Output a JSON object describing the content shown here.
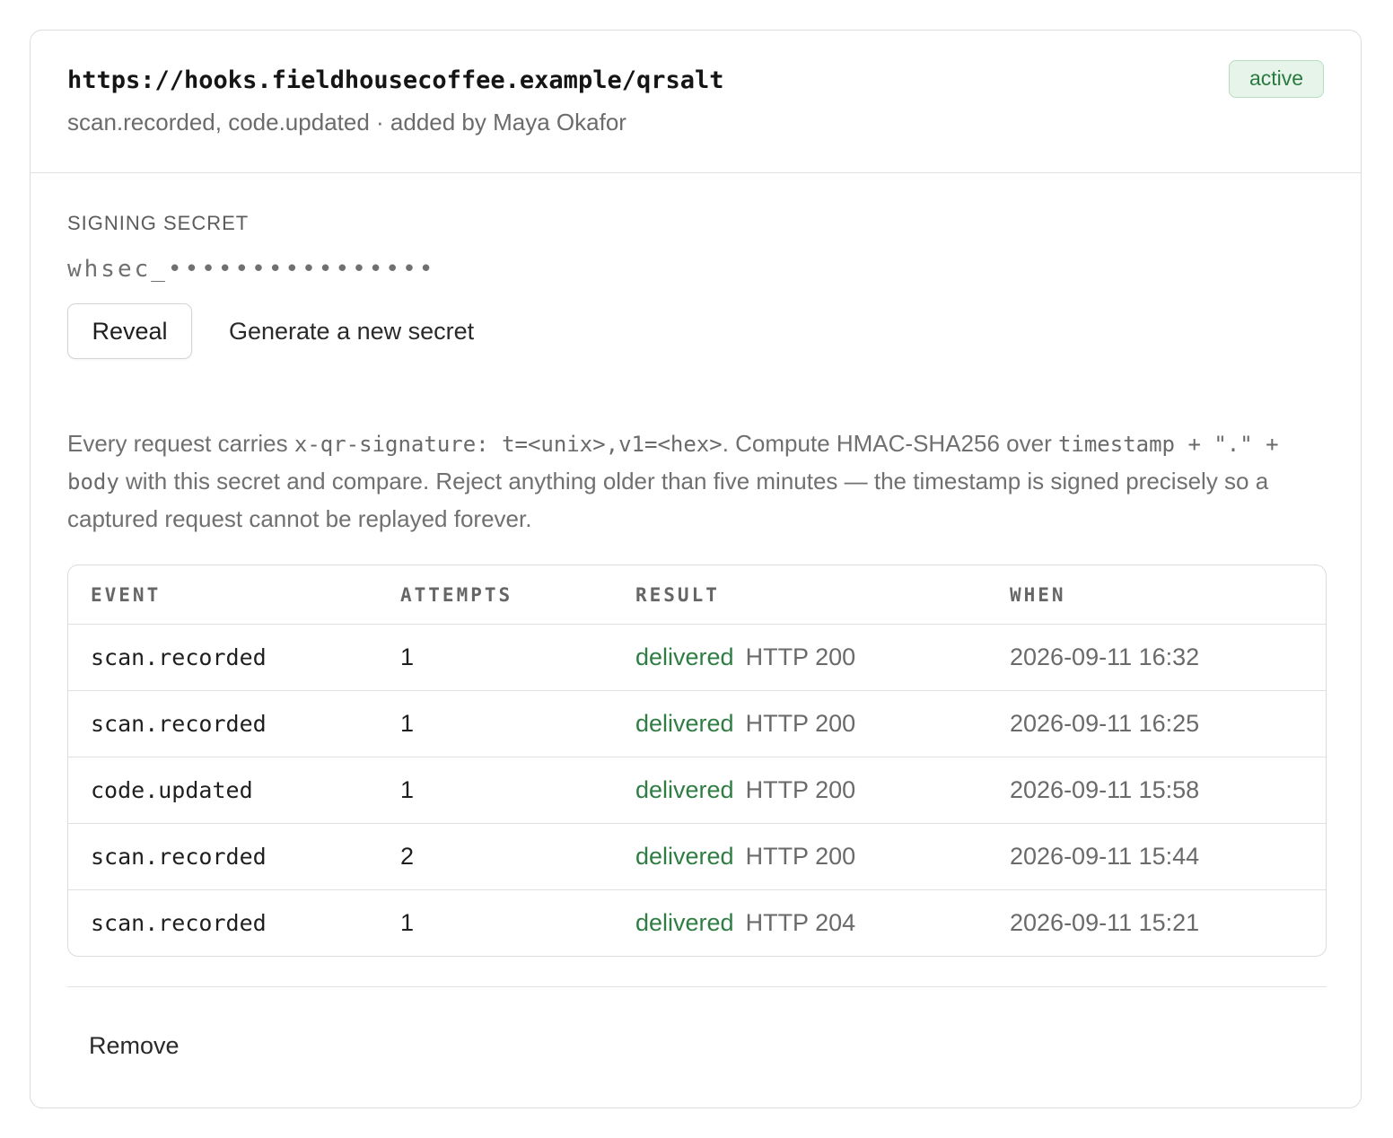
{
  "webhook": {
    "url": "https://hooks.fieldhousecoffee.example/qrsalt",
    "meta": "scan.recorded, code.updated · added by Maya Okafor",
    "status": "active"
  },
  "secret": {
    "label": "SIGNING SECRET",
    "masked_value": "whsec_••••••••••••••••",
    "reveal_label": "Reveal",
    "generate_label": "Generate a new secret"
  },
  "description": {
    "t1": "Every request carries ",
    "c1": "x-qr-signature: t=<unix>,v1=<hex>",
    "t2": ". Compute HMAC-SHA256 over ",
    "c2": "timestamp + \".\" + body",
    "t3": " with this secret and compare. Reject anything older than five minutes — the timestamp is signed precisely so a captured request cannot be replayed forever."
  },
  "deliveries": {
    "headers": [
      "EVENT",
      "ATTEMPTS",
      "RESULT",
      "WHEN"
    ],
    "rows": [
      {
        "event": "scan.recorded",
        "attempts": "1",
        "result": "delivered",
        "http": "HTTP 200",
        "when": "2026-09-11 16:32"
      },
      {
        "event": "scan.recorded",
        "attempts": "1",
        "result": "delivered",
        "http": "HTTP 200",
        "when": "2026-09-11 16:25"
      },
      {
        "event": "code.updated",
        "attempts": "1",
        "result": "delivered",
        "http": "HTTP 200",
        "when": "2026-09-11 15:58"
      },
      {
        "event": "scan.recorded",
        "attempts": "2",
        "result": "delivered",
        "http": "HTTP 200",
        "when": "2026-09-11 15:44"
      },
      {
        "event": "scan.recorded",
        "attempts": "1",
        "result": "delivered",
        "http": "HTTP 204",
        "when": "2026-09-11 15:21"
      }
    ]
  },
  "footer": {
    "remove_label": "Remove"
  },
  "colors": {
    "status_active_bg": "#e7f4ea",
    "status_active_text": "#2a7a40",
    "delivered": "#2f7d43"
  }
}
